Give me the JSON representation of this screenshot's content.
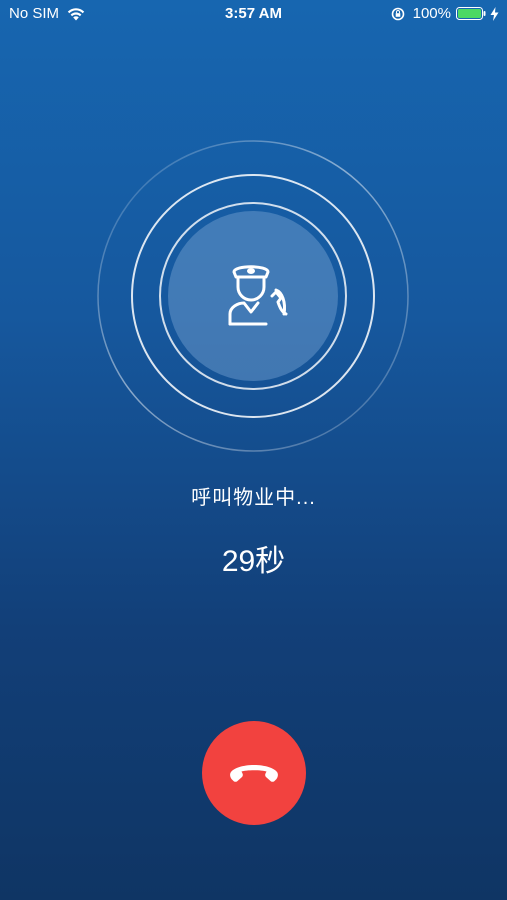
{
  "status_bar": {
    "carrier": "No SIM",
    "time": "3:57 AM",
    "battery": "100%"
  },
  "call": {
    "status_text": "呼叫物业中...",
    "timer_text": "29秒"
  },
  "colors": {
    "hangup": "#f2423f",
    "battery": "#4cd964"
  },
  "icons": {
    "wifi": "wifi-icon",
    "rotation_lock": "rotation-lock-icon",
    "battery": "battery-icon",
    "charging": "charging-bolt-icon",
    "agent": "security-guard-phone-icon",
    "hangup": "phone-hangup-icon"
  }
}
